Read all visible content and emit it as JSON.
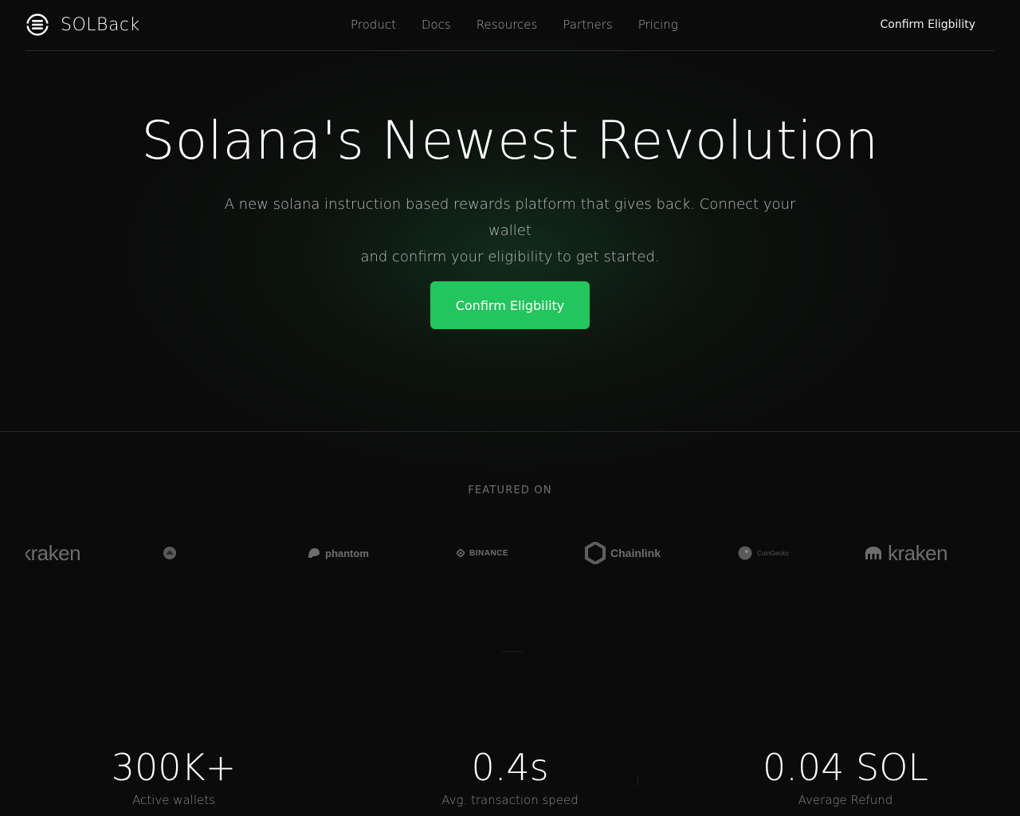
{
  "header": {
    "brand": "SOLBack",
    "nav": [
      "Product",
      "Docs",
      "Resources",
      "Partners",
      "Pricing"
    ],
    "cta": "Confirm Eligbility"
  },
  "hero": {
    "title": "Solana's Newest Revolution",
    "subtitle_line1": "A new solana instruction based rewards platform that gives back. Connect your wallet",
    "subtitle_line2": "and confirm your eligibility to get started.",
    "button": "Confirm Eligbility"
  },
  "featured": {
    "label": "FEATURED ON",
    "partners": [
      "kraken",
      "",
      "phantom",
      "BINANCE",
      "Chainlink",
      "CoinGecko",
      "kraken"
    ]
  },
  "stats": [
    {
      "value": "300K+",
      "label": "Active wallets"
    },
    {
      "value": "0.4s",
      "label": "Avg. transaction speed"
    },
    {
      "value": "0.04 SOL",
      "label": "Average Refund"
    }
  ],
  "colors": {
    "accent": "#22c55e",
    "background": "#0b0b0b"
  }
}
